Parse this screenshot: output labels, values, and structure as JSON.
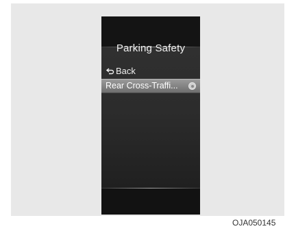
{
  "screen": {
    "title": "Parking Safety",
    "back_label": "Back",
    "menu_items": [
      {
        "label": "Rear Cross-Traffi...",
        "selected": true
      }
    ]
  },
  "figure_code": "OJA050145",
  "colors": {
    "screen_bg": "#161616",
    "highlight": "#8a8a8a",
    "text": "#f2f2f2"
  }
}
